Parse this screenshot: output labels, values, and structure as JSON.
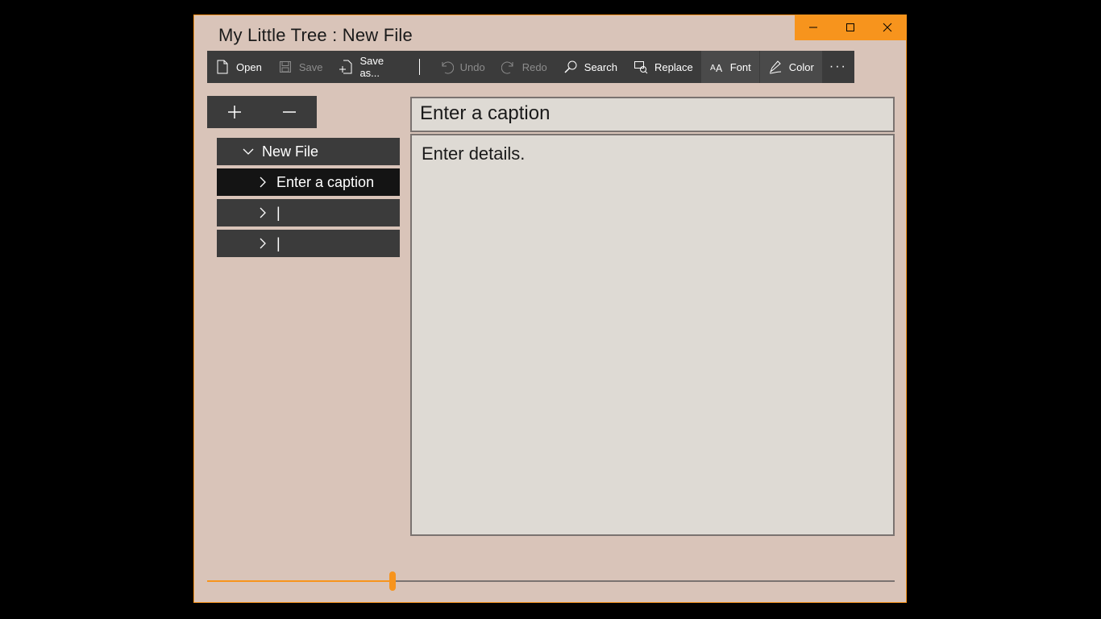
{
  "window": {
    "title": "My Little Tree : New File"
  },
  "toolbar": {
    "open": "Open",
    "save": "Save",
    "save_as": "Save as...",
    "undo": "Undo",
    "redo": "Redo",
    "search": "Search",
    "replace": "Replace",
    "font": "Font",
    "color": "Color",
    "more": "···"
  },
  "tree": {
    "root": "New File",
    "items": [
      "Enter a caption",
      "|",
      "|"
    ]
  },
  "editor": {
    "caption": "Enter a caption",
    "details": "Enter details."
  },
  "slider": {
    "value_fraction": 0.27
  },
  "colors": {
    "accent": "#f7941d",
    "window_bg": "#d9c4b9",
    "toolbar_bg": "#3b3b3b"
  }
}
